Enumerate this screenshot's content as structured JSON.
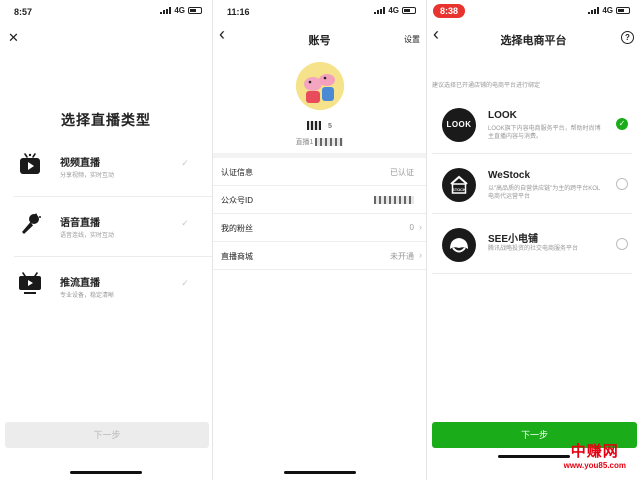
{
  "panel1": {
    "status": {
      "time": "8:57",
      "network": "4G"
    },
    "close_label": "✕",
    "title": "选择直播类型",
    "types": [
      {
        "name": "视频直播",
        "desc": "分享视频，实时互动"
      },
      {
        "name": "语音直播",
        "desc": "语音连线，实时互动"
      },
      {
        "name": "推流直播",
        "desc": "专业设备，稳定清晰"
      }
    ],
    "next_label": "下一步"
  },
  "panel2": {
    "status": {
      "time": "11:16",
      "network": "4G"
    },
    "back_label": "‹",
    "title": "账号",
    "settings_label": "设置",
    "nickname_suffix": "5",
    "sub_id_prefix": "直播1",
    "rows": [
      {
        "label": "认证信息",
        "value": "已认证",
        "chevron": false
      },
      {
        "label": "公众号ID",
        "value": "",
        "chevron": false
      },
      {
        "label": "我的粉丝",
        "value": "0",
        "chevron": true
      },
      {
        "label": "直播商城",
        "value": "未开通",
        "chevron": true
      }
    ]
  },
  "panel3": {
    "status": {
      "time": "8:38",
      "network": "4G"
    },
    "back_label": "‹",
    "title": "选择电商平台",
    "help_label": "?",
    "hint": "建议选择已开通店铺的电商平台进行绑定",
    "platforms": [
      {
        "name": "LOOK",
        "logo_text": "LOOK",
        "desc": "LOOK旗下内容电商服务平台，帮助时尚博主直播内容与消费。",
        "selected": true
      },
      {
        "name": "WeStock",
        "logo_text": "STOCK",
        "desc": "以\"高品质的自营供应链\"为主的跨平台KOL电商代运营平台",
        "selected": false
      },
      {
        "name": "SEE小电铺",
        "logo_text": "",
        "desc": "腾讯战略投资的社交电商服务平台",
        "selected": false
      }
    ],
    "next_label": "下一步"
  },
  "watermark": {
    "title": "中赚网",
    "url": "www.you85.com"
  },
  "colors": {
    "accent": "#1aad19",
    "watermark": "#e60012",
    "disabled_button": "#ececec"
  }
}
